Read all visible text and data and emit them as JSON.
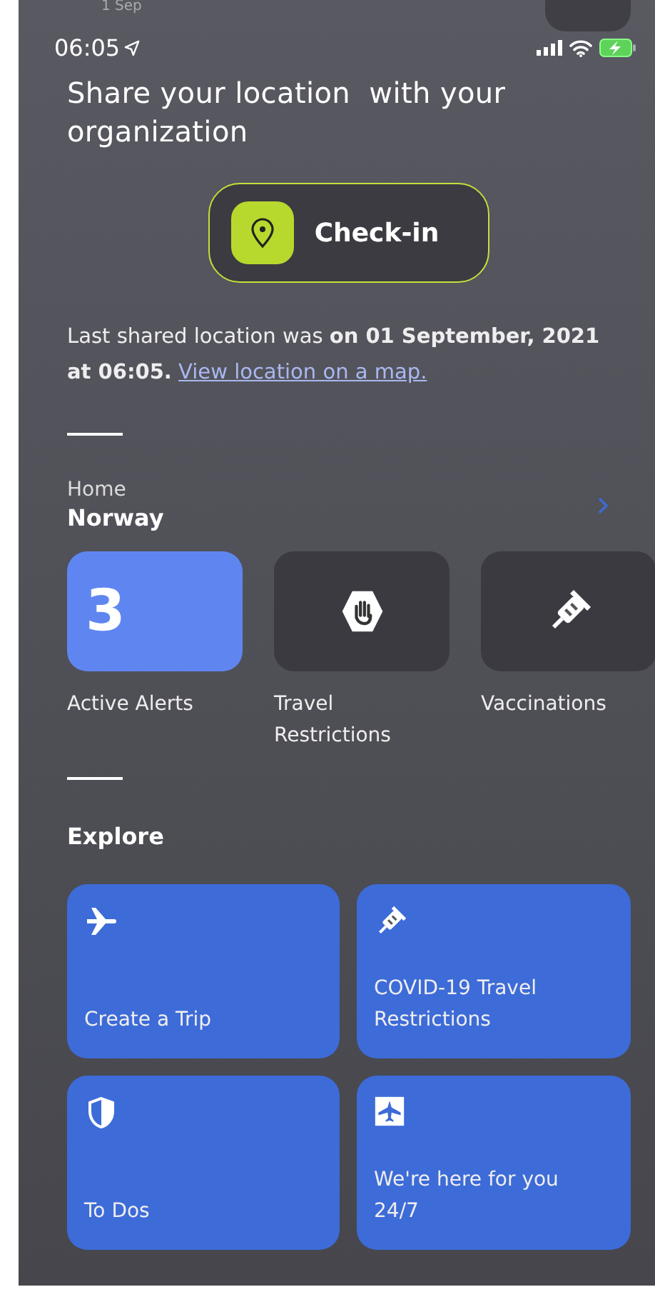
{
  "status_bar": {
    "date": "1 Sep",
    "time": "06:05"
  },
  "title": "Share your location  with your organization",
  "check_in_button": {
    "label": "Check-in"
  },
  "last_shared": {
    "text": "Last shared location was **on 01 September, 2021 at 06:05.**",
    "link": "View location on a map."
  },
  "home": {
    "label": "Home",
    "country": "Norway"
  },
  "quick_tiles": [
    {
      "kind": "count",
      "value": "3",
      "label": "Active Alerts"
    },
    {
      "kind": "hand",
      "label": "Travel Restrictions"
    },
    {
      "kind": "syringe",
      "label": "Vaccinations"
    }
  ],
  "explore": {
    "title": "Explore",
    "tiles": [
      {
        "kind": "plane",
        "label": "Create a Trip"
      },
      {
        "kind": "syringe",
        "label": "COVID-19 Travel Restrictions"
      },
      {
        "kind": "shield",
        "label": "To Dos"
      },
      {
        "kind": "plane-box",
        "label": "We're here for you 24/7"
      }
    ]
  }
}
